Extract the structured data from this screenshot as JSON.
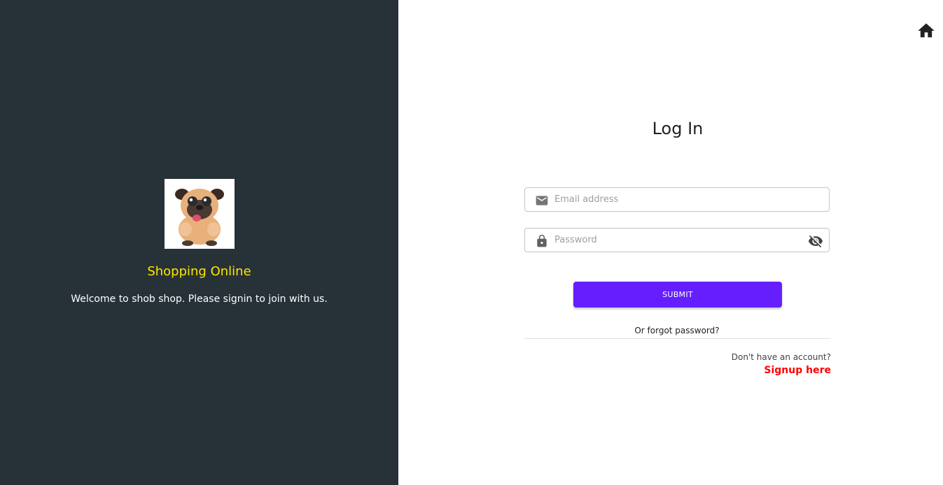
{
  "left_panel": {
    "brand_title": "Shopping Online",
    "welcome_text": "Welcome to shob shop. Please signin to join with us.",
    "logo_icon": "pug-dog-logo",
    "colors": {
      "background": "#263238",
      "brand": "#ffe600"
    }
  },
  "header": {
    "home_icon": "home-icon"
  },
  "login_form": {
    "title": "Log In",
    "email": {
      "placeholder": "Email address",
      "value": "",
      "icon": "email-icon"
    },
    "password": {
      "placeholder": "Password",
      "value": "",
      "icon": "lock-icon",
      "toggle_icon": "visibility-off-icon"
    },
    "submit_label": "SUBMIT",
    "forgot_label": "Or forgot password?",
    "no_account_label": "Don't have an account?",
    "signup_label": "Signup here",
    "colors": {
      "submit": "#651fff",
      "signup": "#ff0000"
    }
  }
}
